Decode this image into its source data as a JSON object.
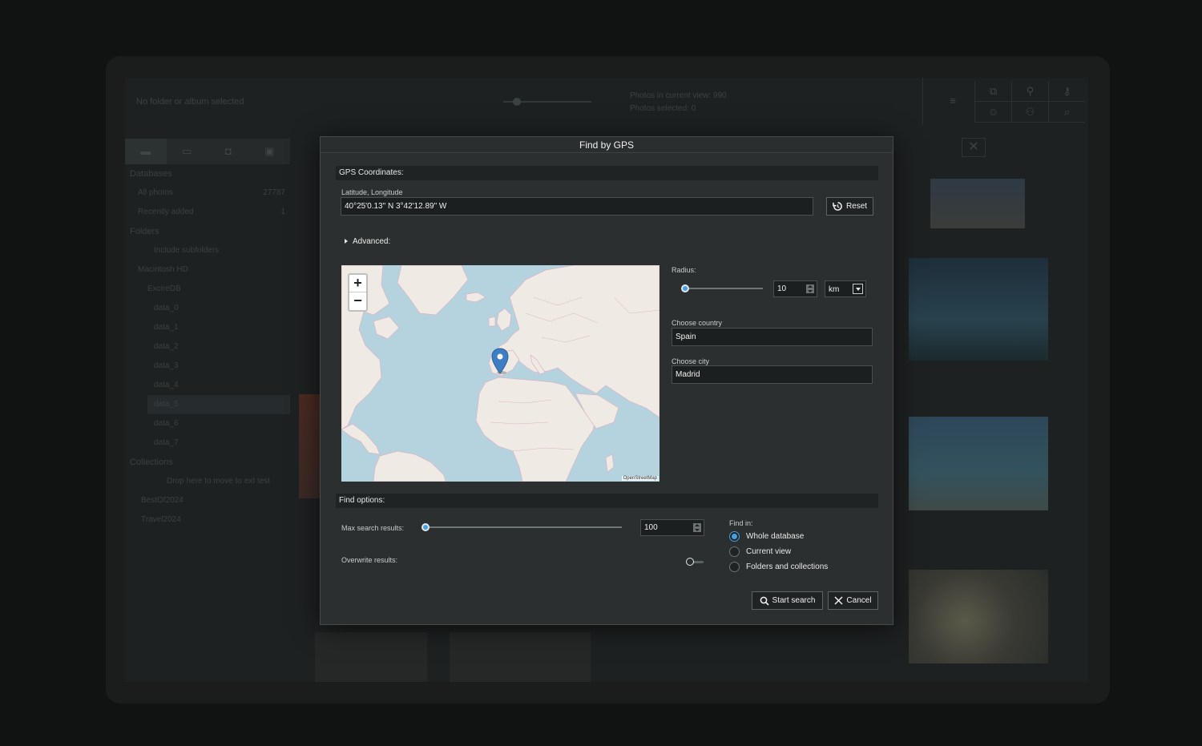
{
  "background_app": {
    "title": "No folder or album selected",
    "photos_in_view": "Photos in current view: 990",
    "photos_selected": "Photos selected: 0",
    "sidebar": {
      "databases_header": "Databases",
      "all_photos": "All photos",
      "all_photos_count": "27787",
      "recently_added": "Recently added",
      "recently_added_count": "1",
      "folders_header": "Folders",
      "include_subfolders": "Include subfolders",
      "drive": "Macintosh HD",
      "root_folder": "ExcireDB",
      "folders": [
        "data_0",
        "data_1",
        "data_2",
        "data_3",
        "data_4",
        "data_5",
        "data_6",
        "data_7"
      ],
      "collections_header": "Collections",
      "drop_hint": "Drop here to move to ext test",
      "collections": [
        "BestOf2024",
        "Travel2024"
      ]
    }
  },
  "dialog": {
    "title": "Find by GPS",
    "gps_section": "GPS Coordinates:",
    "latlon_label": "Latitude, Longitude",
    "latlon_value": "40°25'0.13\" N 3°42'12.89\" W",
    "reset_label": "Reset",
    "advanced_label": "Advanced:",
    "map": {
      "zoom_in": "+",
      "zoom_out": "−",
      "attribution": "OpenStreetMap",
      "marker": "map-pin",
      "marker_color": "#3e7fc3"
    },
    "radius_label": "Radius:",
    "radius_value": "10",
    "radius_unit": "km",
    "country_label": "Choose country",
    "country_value": "Spain",
    "city_label": "Choose city",
    "city_value": "Madrid",
    "find_options_section": "Find options:",
    "max_results_label": "Max search results:",
    "max_results_value": "100",
    "overwrite_label": "Overwrite results:",
    "find_in_label": "Find in:",
    "find_in_options": [
      "Whole database",
      "Current view",
      "Folders and collections"
    ],
    "find_in_selected": "Whole database",
    "start_search_label": "Start search",
    "cancel_label": "Cancel",
    "accent_color": "#4a9fe0"
  }
}
